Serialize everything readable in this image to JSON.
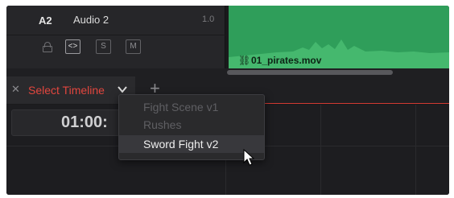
{
  "track": {
    "id": "A2",
    "name": "Audio 2",
    "level": "1.0",
    "buttons": {
      "link": "<>",
      "solo": "S",
      "mute": "M"
    }
  },
  "clip": {
    "name": "01_pirates.mov"
  },
  "tab": {
    "label": "Select Timeline"
  },
  "timecode": "01:00:",
  "menu": {
    "items": [
      {
        "label": "Fight Scene v1",
        "state": "disabled"
      },
      {
        "label": "Rushes",
        "state": "disabled"
      },
      {
        "label": "Sword Fight v2",
        "state": "hover"
      }
    ]
  },
  "colors": {
    "clip": "#2f9e5a",
    "tab_accent": "#e2463e",
    "background": "#1d1d20"
  }
}
